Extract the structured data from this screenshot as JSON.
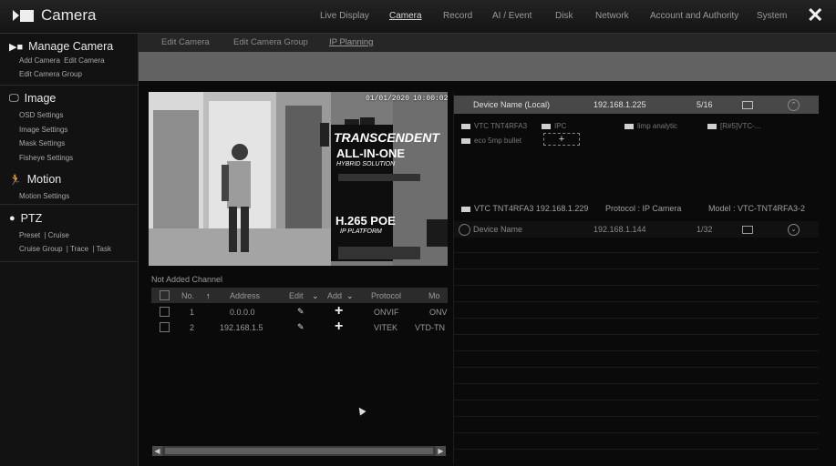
{
  "app": {
    "title": "Camera",
    "icon": "camera-icon"
  },
  "topnav": [
    "Live Display",
    "Camera",
    "Record",
    "AI / Event",
    "Disk",
    "Network",
    "Account and Authority",
    "System"
  ],
  "topnav_active": "Camera",
  "sidebar": {
    "manage": {
      "title": "Manage Camera",
      "items": [
        "Add Camera",
        "Edit Camera",
        "Edit Camera Group"
      ]
    },
    "image": {
      "title": "Image",
      "items": [
        "OSD Settings",
        "Image Settings",
        "Mask Settings",
        "Fisheye Settings"
      ]
    },
    "motion": {
      "title": "Motion",
      "items": [
        "Motion Settings"
      ]
    },
    "ptz": {
      "title": "PTZ",
      "items": [
        "Preset",
        "Cruise",
        "Cruise Group",
        "Trace",
        "Task"
      ]
    }
  },
  "subtabs": [
    "Edit Camera",
    "Edit Camera Group",
    "IP Planning"
  ],
  "subtab_active": "IP Planning",
  "video": {
    "osd_date": "01/01/2020",
    "osd_time": "10:00:02",
    "poster_brand": "TRANSCENDENT",
    "poster_sub": "ALL-IN-ONE",
    "poster_sub2": "HYBRID SOLUTION",
    "poster_codec": "H.265 POE",
    "poster_platform": "IP PLATFORM"
  },
  "not_added": {
    "title": "Not Added Channel",
    "columns": [
      "No.",
      "Address",
      "Edit",
      "Add",
      "Protocol",
      "Mo"
    ],
    "rows": [
      {
        "no": "1",
        "address": "0.0.0.0",
        "protocol": "ONVIF",
        "model": "ONV"
      },
      {
        "no": "2",
        "address": "192.168.1.5",
        "protocol": "VITEK",
        "model": "VTD-TN"
      }
    ]
  },
  "device_local": {
    "name": "Device Name (Local)",
    "ip": "192.168.1.225",
    "count": "5/16",
    "cameras": [
      "VTC TNT4RFA3",
      "IPC",
      "limp analytic",
      "[R#5]VTC-...",
      "eco 5mp bullet"
    ],
    "status": {
      "camera": "VTC TNT4RFA3",
      "ip": "192.168.1.229",
      "protocol": "Protocol : IP Camera",
      "model": "Model : VTC-TNT4RFA3-2"
    }
  },
  "device_remote": {
    "name": "Device Name",
    "ip": "192.168.1.144",
    "count": "1/32"
  }
}
